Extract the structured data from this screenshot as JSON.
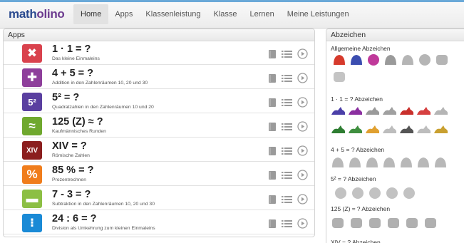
{
  "logo": {
    "part1": "math",
    "part2": "olino"
  },
  "nav": [
    "Home",
    "Apps",
    "Klassenleistung",
    "Klasse",
    "Lernen",
    "Meine Leistungen"
  ],
  "apps_panel": {
    "title": "Apps"
  },
  "apps": [
    {
      "title": "1 · 1 = ?",
      "subtitle": "Das kleine Einmaleins",
      "icon_text": "✖",
      "color": "#d9424d"
    },
    {
      "title": "4 + 5 = ?",
      "subtitle": "Addition in den Zahlenräumen 10, 20 und 30",
      "icon_text": "✚",
      "color": "#8e3f9b"
    },
    {
      "title": "5² = ?",
      "subtitle": "Quadratzahlen in den Zahlenräumen 10 und 20",
      "icon_text": "5²",
      "color": "#5a3fa0"
    },
    {
      "title": "125 (Z) ≈ ?",
      "subtitle": "Kaufmännisches Runden",
      "icon_text": "≈",
      "color": "#6fa82e"
    },
    {
      "title": "XIV = ?",
      "subtitle": "Römische Zahlen",
      "icon_text": "XIV",
      "color": "#8b1e1e"
    },
    {
      "title": "85 % = ?",
      "subtitle": "Prozentrechnen",
      "icon_text": "%",
      "color": "#f07d1c"
    },
    {
      "title": "7 - 3 = ?",
      "subtitle": "Subtraktion in den Zahlenräumen 10, 20 und 30",
      "icon_text": "▬",
      "color": "#8cbf44"
    },
    {
      "title": "24 : 6 = ?",
      "subtitle": "Division als Umkehrung zum kleinen Einmaleins",
      "icon_text": "⁝",
      "color": "#1a8ad6"
    }
  ],
  "badges_panel": {
    "title": "Abzeichen",
    "sections": [
      {
        "title": "Allgemeine Abzeichen"
      },
      {
        "title": "1 · 1 = ? Abzeichen"
      },
      {
        "title": "4 + 5 = ? Abzeichen"
      },
      {
        "title": "5² = ? Abzeichen"
      },
      {
        "title": "125 (Z) ≈ ? Abzeichen"
      },
      {
        "title": "XIV = ? Abzeichen"
      }
    ]
  },
  "colors": {
    "accent_blue": "#6aa9d8",
    "badge_grey": "#bfbfbf"
  }
}
